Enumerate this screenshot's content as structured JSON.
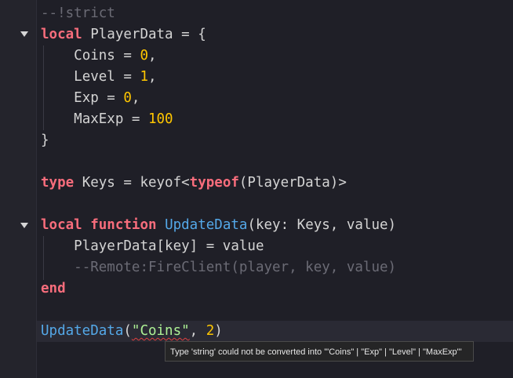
{
  "lines": {
    "l1": {
      "comment": "--!strict"
    },
    "l2": {
      "kw_local": "local",
      "name": "PlayerData",
      "rest": " = {"
    },
    "l3": {
      "key": "Coins",
      "op": " = ",
      "num": "0",
      "tail": ","
    },
    "l4": {
      "key": "Level",
      "op": " = ",
      "num": "1",
      "tail": ","
    },
    "l5": {
      "key": "Exp",
      "op": " = ",
      "num": "0",
      "tail": ","
    },
    "l6": {
      "key": "MaxExp",
      "op": " = ",
      "num": "100"
    },
    "l7": {
      "text": "}"
    },
    "l9": {
      "kw_type": "type",
      "mid": " Keys = keyof<",
      "kw_typeof": "typeof",
      "tail": "(PlayerData)>"
    },
    "l11": {
      "kw_local": "local",
      "kw_function": "function",
      "fn": "UpdateData",
      "params": "(key: Keys, value)"
    },
    "l12": {
      "text": "PlayerData[key] = value"
    },
    "l13": {
      "comment": "--Remote:FireClient(player, key, value)"
    },
    "l14": {
      "kw_end": "end"
    },
    "l16": {
      "fn": "UpdateData",
      "open": "(",
      "str": "\"Coins\"",
      "sep": ", ",
      "num": "2",
      "close": ")"
    }
  },
  "tooltip": {
    "text": "Type 'string' could not be converted into '\"Coins\" | \"Exp\" | \"Level\" | \"MaxExp\"'"
  }
}
